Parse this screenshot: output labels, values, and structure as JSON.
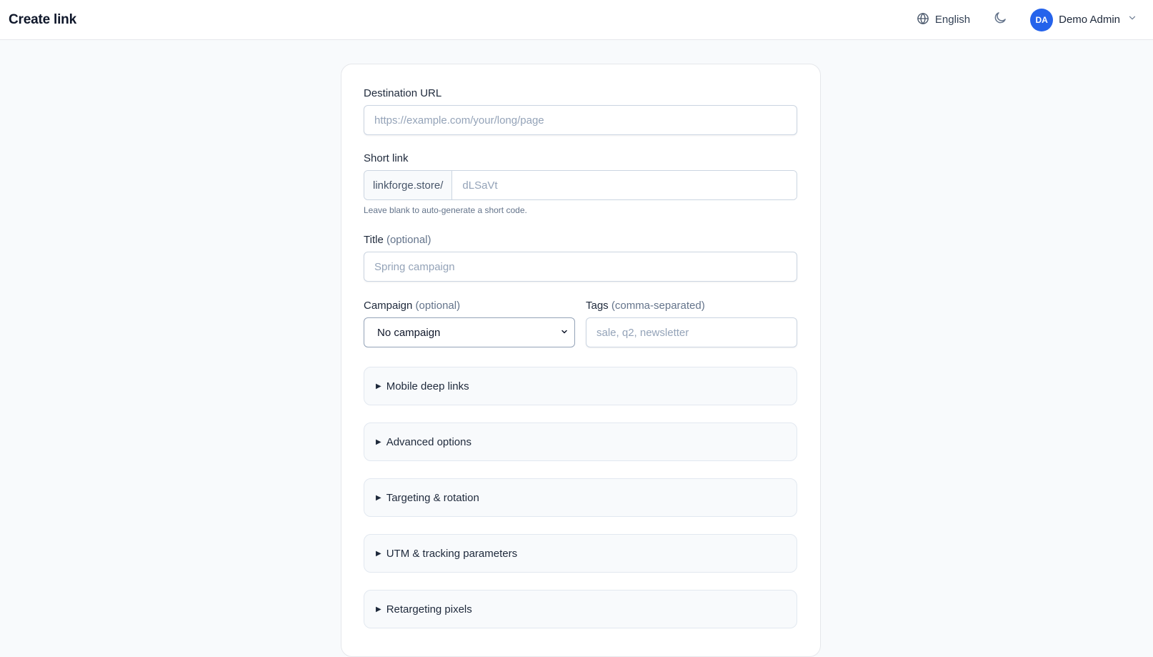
{
  "header": {
    "title": "Create link",
    "language_label": "English",
    "user": {
      "initials": "DA",
      "name": "Demo Admin"
    }
  },
  "form": {
    "destination": {
      "label": "Destination URL",
      "placeholder": "https://example.com/your/long/page"
    },
    "short_link": {
      "label": "Short link",
      "prefix": "linkforge.store/",
      "placeholder": "dLSaVt",
      "hint": "Leave blank to auto-generate a short code."
    },
    "title": {
      "label": "Title",
      "optional": "(optional)",
      "placeholder": "Spring campaign"
    },
    "campaign": {
      "label": "Campaign",
      "optional": "(optional)",
      "selected": "No campaign"
    },
    "tags": {
      "label": "Tags",
      "optional": "(comma-separated)",
      "placeholder": "sale, q2, newsletter"
    },
    "sections": [
      {
        "label": "Mobile deep links"
      },
      {
        "label": "Advanced options"
      },
      {
        "label": "Targeting & rotation"
      },
      {
        "label": "UTM & tracking parameters"
      },
      {
        "label": "Retargeting pixels"
      }
    ]
  },
  "colors": {
    "accent": "#2563eb",
    "background": "#f8fafc",
    "card": "#ffffff",
    "border": "#cbd5e1"
  },
  "icons": {
    "language": "globe-icon",
    "theme": "moon-icon",
    "user_menu": "chevron-down-icon",
    "section": "caret-right-icon",
    "select": "chevron-down-icon"
  }
}
